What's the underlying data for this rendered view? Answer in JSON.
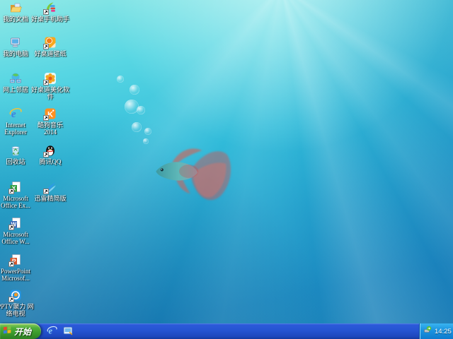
{
  "desktop": {
    "icons": [
      {
        "name": "my-documents",
        "line1": "我的文档",
        "line2": ""
      },
      {
        "name": "my-computer",
        "line1": "我的电脑",
        "line2": ""
      },
      {
        "name": "my-network-places",
        "line1": "网上邻居",
        "line2": ""
      },
      {
        "name": "internet-explorer",
        "line1": "Internet",
        "line2": "Explorer"
      },
      {
        "name": "recycle-bin",
        "line1": "回收站",
        "line2": ""
      },
      {
        "name": "microsoft-office-excel",
        "line1": "Microsoft",
        "line2": "Office Ex..."
      },
      {
        "name": "microsoft-office-word",
        "line1": "Microsoft",
        "line2": "Office W..."
      },
      {
        "name": "powerpoint",
        "line1": "PowerPoint",
        "line2": "Microsof..."
      },
      {
        "name": "pptv-network-tv",
        "line1": "PPTV聚力 网",
        "line2": "络电视"
      },
      {
        "name": "haozhuo-phone-assistant",
        "line1": "好桌手机助手",
        "line2": ""
      },
      {
        "name": "haozhuodao-wallpaper",
        "line1": "好桌道壁纸",
        "line2": ""
      },
      {
        "name": "haozhuodao-beautify",
        "line1": "好桌道美化软",
        "line2": "件"
      },
      {
        "name": "kugou-music-2014",
        "line1": "酷狗音乐",
        "line2": "2014"
      },
      {
        "name": "tencent-qq",
        "line1": "腾讯QQ",
        "line2": ""
      },
      {
        "name": "thunder-lite",
        "line1": "迅雷精简版",
        "line2": ""
      }
    ]
  },
  "taskbar": {
    "start_label": "开始",
    "clock": "14:25"
  },
  "colors": {
    "sea_light_top": "#8fe9e6",
    "sea_dark_bottom": "#1e85ba",
    "taskbar_blue": "#2554d2",
    "start_button_green": "#3a9a2d",
    "tray_blue": "#1c96e2",
    "label_text": "#ffffff"
  }
}
